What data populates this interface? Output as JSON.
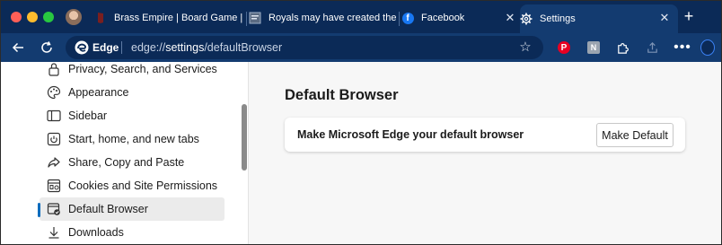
{
  "tabs": [
    {
      "title": "Brass Empire | Board Game | B",
      "icon": "brass-empire-favicon"
    },
    {
      "title": "Royals may have created the r",
      "icon": "article-favicon"
    },
    {
      "title": "Facebook",
      "icon": "facebook-favicon",
      "badge": "f"
    },
    {
      "title": "Settings",
      "icon": "gear-icon",
      "active": true
    }
  ],
  "toolbar": {
    "site_label": "Edge",
    "url_prefix": "edge://",
    "url_path": "settings",
    "url_suffix": "/defaultBrowser",
    "pinterest_badge": "P",
    "ext_badge": "N",
    "menu_dots": "•••"
  },
  "sidebar": {
    "items": [
      {
        "label": "Privacy, Search, and Services",
        "icon": "lock-icon"
      },
      {
        "label": "Appearance",
        "icon": "palette-icon"
      },
      {
        "label": "Sidebar",
        "icon": "sidebar-icon"
      },
      {
        "label": "Start, home, and new tabs",
        "icon": "power-icon"
      },
      {
        "label": "Share, Copy and Paste",
        "icon": "share-icon"
      },
      {
        "label": "Cookies and Site Permissions",
        "icon": "permissions-icon"
      },
      {
        "label": "Default Browser",
        "icon": "browser-icon",
        "active": true
      },
      {
        "label": "Downloads",
        "icon": "download-icon"
      }
    ]
  },
  "main": {
    "title": "Default Browser",
    "card_label": "Make Microsoft Edge your default browser",
    "button_label": "Make Default"
  },
  "colors": {
    "tabstrip": "#0b2a57",
    "toolbar": "#133b70",
    "accent": "#0f6cbd"
  }
}
